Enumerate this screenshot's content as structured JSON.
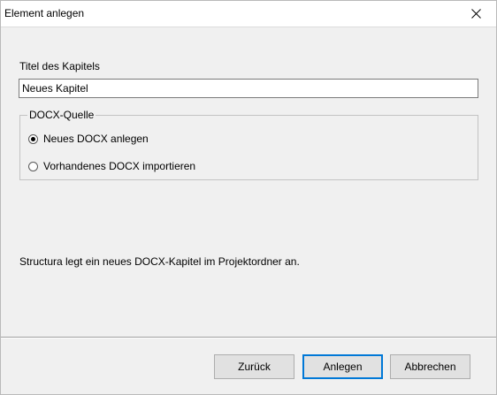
{
  "window": {
    "title": "Element anlegen"
  },
  "form": {
    "title_label": "Titel des Kapitels",
    "title_value": "Neues Kapitel"
  },
  "source_group": {
    "legend": "DOCX-Quelle",
    "options": [
      {
        "label": "Neues DOCX anlegen",
        "selected": true
      },
      {
        "label": "Vorhandenes DOCX importieren",
        "selected": false
      }
    ]
  },
  "info_text": "Structura legt ein neues DOCX-Kapitel im Projektordner an.",
  "buttons": {
    "back": "Zurück",
    "create": "Anlegen",
    "cancel": "Abbrechen"
  },
  "colors": {
    "accent": "#0078d7",
    "background": "#f0f0f0"
  },
  "icons": {
    "close": "close-icon"
  }
}
